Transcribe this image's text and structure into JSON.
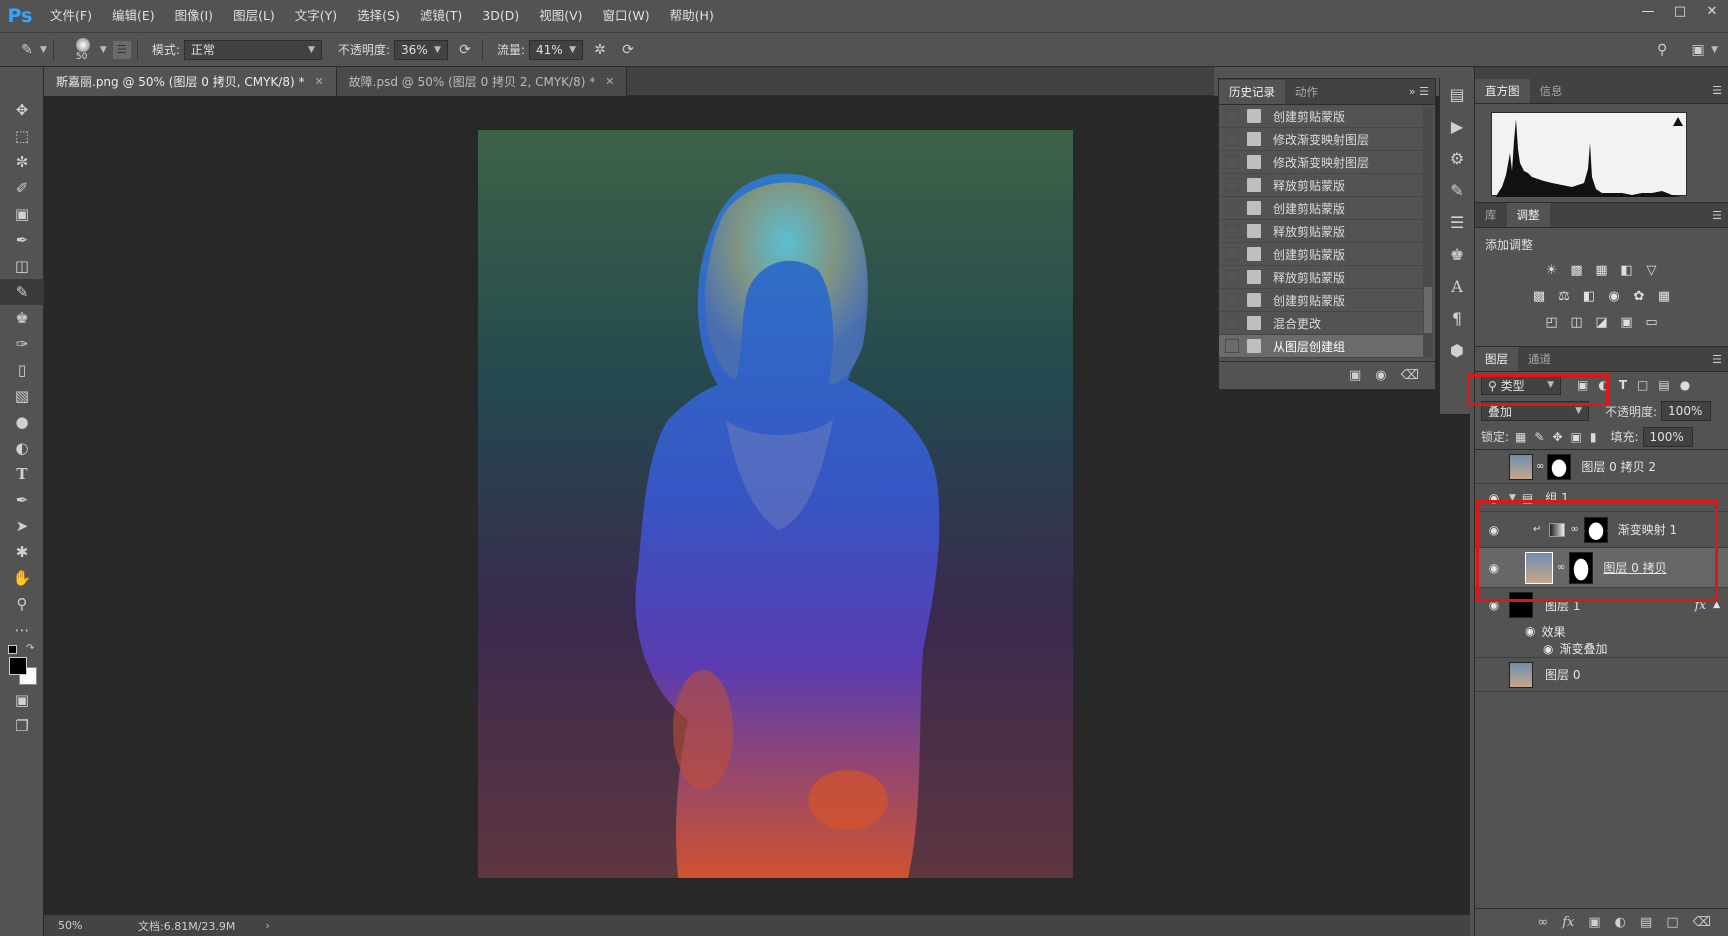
{
  "menubar": {
    "logo": "Ps",
    "items": [
      "文件(F)",
      "编辑(E)",
      "图像(I)",
      "图层(L)",
      "文字(Y)",
      "选择(S)",
      "滤镜(T)",
      "3D(D)",
      "视图(V)",
      "窗口(W)",
      "帮助(H)"
    ]
  },
  "options": {
    "brush_size": "50",
    "mode_label": "模式:",
    "mode_value": "正常",
    "opacity_label": "不透明度:",
    "opacity_value": "36%",
    "flow_label": "流量:",
    "flow_value": "41%"
  },
  "tabs": [
    {
      "label": "斯嘉丽.png @ 50% (图层 0 拷贝, CMYK/8) *"
    },
    {
      "label": "故障.psd @ 50% (图层 0 拷贝 2, CMYK/8) *"
    }
  ],
  "status": {
    "zoom": "50%",
    "doc": "文档:6.81M/23.9M"
  },
  "history": {
    "tabs": [
      "历史记录",
      "动作"
    ],
    "items": [
      "创建剪贴蒙版",
      "修改渐变映射图层",
      "修改渐变映射图层",
      "释放剪贴蒙版",
      "创建剪贴蒙版",
      "释放剪贴蒙版",
      "创建剪贴蒙版",
      "释放剪贴蒙版",
      "创建剪贴蒙版",
      "混合更改",
      "从图层创建组"
    ]
  },
  "histogram": {
    "tabs": [
      "直方图",
      "信息"
    ]
  },
  "adjust": {
    "tabs": [
      "库",
      "调整"
    ],
    "title": "添加调整"
  },
  "layers": {
    "tabs": [
      "图层",
      "通道"
    ],
    "filter": "类型",
    "blend_mode": "叠加",
    "opacity_label": "不透明度:",
    "opacity_value": "100%",
    "lock_label": "锁定:",
    "fill_label": "填充:",
    "fill_value": "100%",
    "rows": {
      "copy2": "图层 0 拷贝 2",
      "group": "组 1",
      "gradmap": "渐变映射 1",
      "copy": "图层 0 拷贝",
      "layer1": "图层 1",
      "effects": "效果",
      "gradover": "渐变叠加",
      "layer0": "图层 0"
    }
  },
  "colors": {
    "highlight": "#e01515",
    "accent": "#36a3ff"
  }
}
